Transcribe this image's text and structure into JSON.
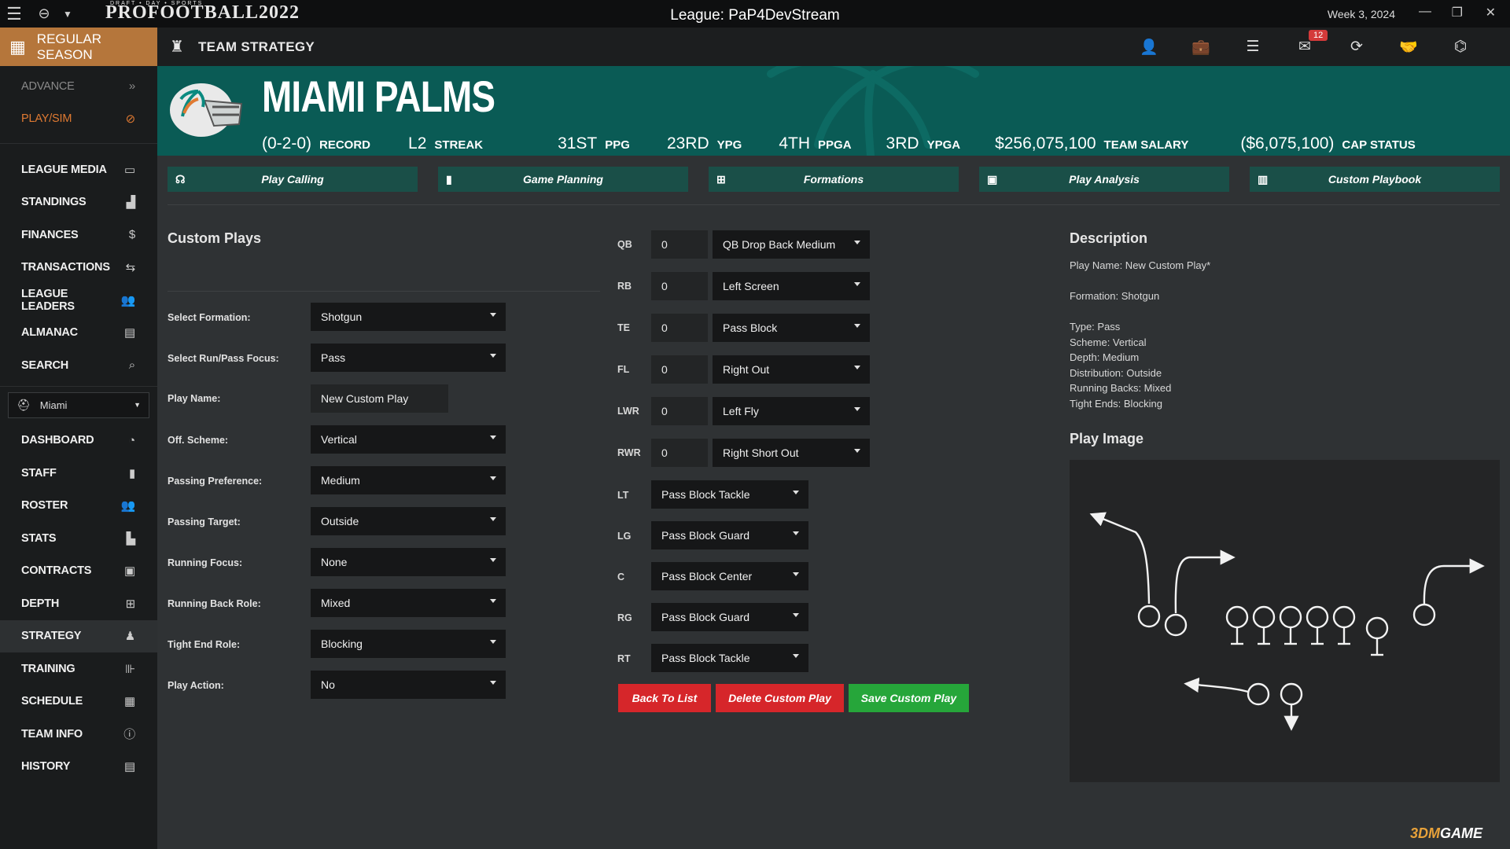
{
  "app": {
    "logo_small": "DRAFT • DAY • SPORTS",
    "logo": "PROFOOTBALL2022",
    "window_title": "League: PaP4DevStream",
    "week": "Week 3, 2024"
  },
  "season": {
    "label": "REGULAR SEASON"
  },
  "header": {
    "title": "TEAM STRATEGY",
    "mail_badge": "12"
  },
  "sidebar": {
    "top": [
      {
        "label": "ADVANCE",
        "icon": "»"
      },
      {
        "label": "PLAY/SIM",
        "icon": "⊘"
      }
    ],
    "league": [
      {
        "label": "LEAGUE MEDIA",
        "icon": "▭"
      },
      {
        "label": "STANDINGS",
        "icon": "▟"
      },
      {
        "label": "FINANCES",
        "icon": "$"
      },
      {
        "label": "TRANSACTIONS",
        "icon": "⇆"
      },
      {
        "label": "LEAGUE LEADERS",
        "icon": "👥"
      },
      {
        "label": "ALMANAC",
        "icon": "▤"
      },
      {
        "label": "SEARCH",
        "icon": "⌕"
      }
    ],
    "team_select": "Miami",
    "team": [
      {
        "label": "DASHBOARD",
        "icon": "◔"
      },
      {
        "label": "STAFF",
        "icon": "▮"
      },
      {
        "label": "ROSTER",
        "icon": "👥"
      },
      {
        "label": "STATS",
        "icon": "▙"
      },
      {
        "label": "CONTRACTS",
        "icon": "▣"
      },
      {
        "label": "DEPTH",
        "icon": "⊞"
      },
      {
        "label": "STRATEGY",
        "icon": "♟"
      },
      {
        "label": "TRAINING",
        "icon": "⊪"
      },
      {
        "label": "SCHEDULE",
        "icon": "▦"
      },
      {
        "label": "TEAM INFO",
        "icon": "ⓘ"
      },
      {
        "label": "HISTORY",
        "icon": "▤"
      }
    ]
  },
  "team": {
    "name": "MIAMI PALMS",
    "stats": [
      {
        "value": "(0-2-0)",
        "label": "RECORD"
      },
      {
        "value": "L2",
        "label": "STREAK"
      },
      {
        "value": "31ST",
        "label": "PPG"
      },
      {
        "value": "23RD",
        "label": "YPG"
      },
      {
        "value": "4TH",
        "label": "PPGA"
      },
      {
        "value": "3RD",
        "label": "YPGA"
      },
      {
        "value": "$256,075,100",
        "label": "TEAM SALARY"
      },
      {
        "value": "($6,075,100)",
        "label": "CAP STATUS"
      }
    ]
  },
  "tabs": [
    "Play Calling",
    "Game Planning",
    "Formations",
    "Play Analysis",
    "Custom Playbook"
  ],
  "custom_plays": {
    "title": "Custom Plays",
    "fields": [
      {
        "label": "Select Formation:",
        "value": "Shotgun",
        "type": "select"
      },
      {
        "label": "Select Run/Pass Focus:",
        "value": "Pass",
        "type": "select"
      },
      {
        "label": "Play Name:",
        "value": "New Custom Play",
        "type": "text"
      },
      {
        "label": "Off. Scheme:",
        "value": "Vertical",
        "type": "select"
      },
      {
        "label": "Passing Preference:",
        "value": "Medium",
        "type": "select"
      },
      {
        "label": "Passing Target:",
        "value": "Outside",
        "type": "select"
      },
      {
        "label": "Running Focus:",
        "value": "None",
        "type": "select"
      },
      {
        "label": "Running Back Role:",
        "value": "Mixed",
        "type": "select"
      },
      {
        "label": "Tight End Role:",
        "value": "Blocking",
        "type": "select"
      },
      {
        "label": "Play Action:",
        "value": "No",
        "type": "select"
      }
    ]
  },
  "assignments": {
    "skill": [
      {
        "pos": "QB",
        "num": "0",
        "route": "QB Drop Back Medium"
      },
      {
        "pos": "RB",
        "num": "0",
        "route": "Left Screen"
      },
      {
        "pos": "TE",
        "num": "0",
        "route": "Pass Block"
      },
      {
        "pos": "FL",
        "num": "0",
        "route": "Right Out"
      },
      {
        "pos": "LWR",
        "num": "0",
        "route": "Left Fly"
      },
      {
        "pos": "RWR",
        "num": "0",
        "route": "Right Short Out"
      }
    ],
    "line": [
      {
        "pos": "LT",
        "route": "Pass Block Tackle"
      },
      {
        "pos": "LG",
        "route": "Pass Block Guard"
      },
      {
        "pos": "C",
        "route": "Pass Block Center"
      },
      {
        "pos": "RG",
        "route": "Pass Block Guard"
      },
      {
        "pos": "RT",
        "route": "Pass Block Tackle"
      }
    ]
  },
  "buttons": {
    "back": "Back To List",
    "delete": "Delete Custom Play",
    "save": "Save Custom Play"
  },
  "description": {
    "title": "Description",
    "play_name": "Play Name: New Custom Play*",
    "formation": "Formation: Shotgun",
    "lines": [
      "Type: Pass",
      "Scheme: Vertical",
      "Depth: Medium",
      "Distribution: Outside",
      "Running Backs: Mixed",
      "Tight Ends: Blocking"
    ]
  },
  "play_image": {
    "title": "Play Image"
  },
  "watermark": {
    "a": "3DM",
    "b": "GAME"
  },
  "colors": {
    "accent_orange": "#b5763b",
    "teal": "#0a5b55",
    "tab": "#1a4f48",
    "red": "#d6262a",
    "green": "#26a63a"
  }
}
